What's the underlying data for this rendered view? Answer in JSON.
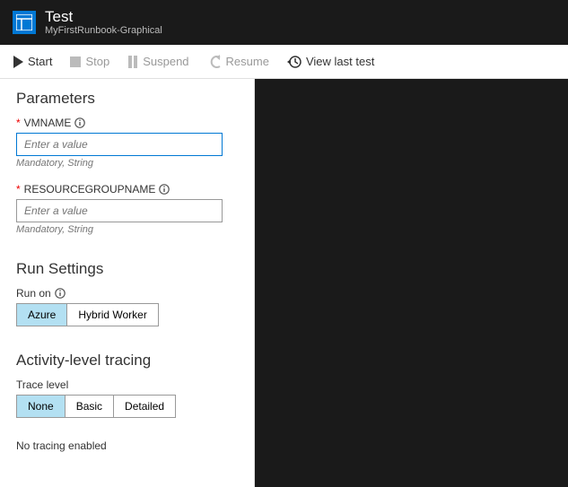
{
  "header": {
    "title": "Test",
    "subtitle": "MyFirstRunbook-Graphical"
  },
  "toolbar": {
    "start": "Start",
    "stop": "Stop",
    "suspend": "Suspend",
    "resume": "Resume",
    "viewLastTest": "View last test"
  },
  "parameters": {
    "heading": "Parameters",
    "vmname": {
      "label": "VMNAME",
      "placeholder": "Enter a value",
      "hint": "Mandatory, String"
    },
    "resourceGroupName": {
      "label": "RESOURCEGROUPNAME",
      "placeholder": "Enter a value",
      "hint": "Mandatory, String"
    }
  },
  "runSettings": {
    "heading": "Run Settings",
    "runOnLabel": "Run on",
    "options": {
      "azure": "Azure",
      "hybrid": "Hybrid Worker"
    }
  },
  "tracing": {
    "heading": "Activity-level tracing",
    "levelLabel": "Trace level",
    "options": {
      "none": "None",
      "basic": "Basic",
      "detailed": "Detailed"
    },
    "message": "No tracing enabled"
  }
}
